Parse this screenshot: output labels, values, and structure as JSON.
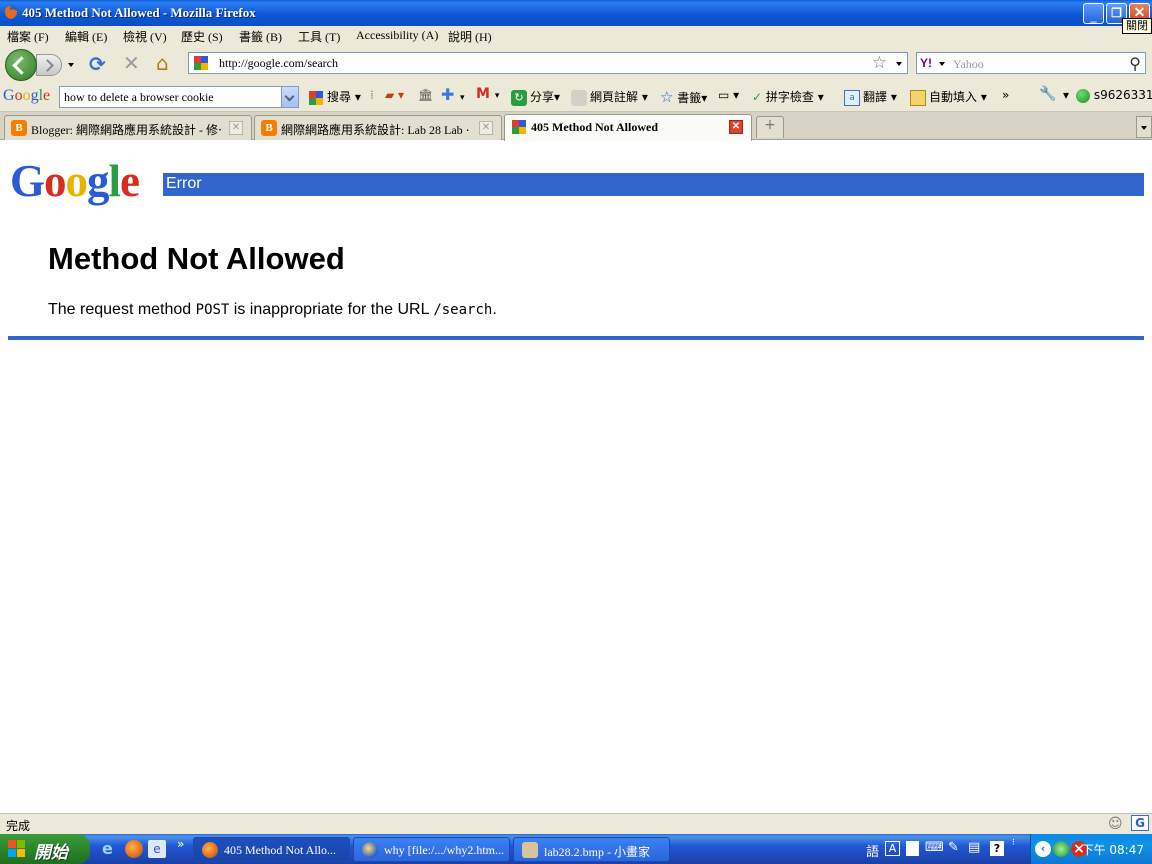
{
  "window": {
    "title": "405 Method Not Allowed - Mozilla Firefox",
    "close_tooltip": "關閉"
  },
  "menu": [
    "檔案 (F)",
    "編輯 (E)",
    "檢視 (V)",
    "歷史 (S)",
    "書籤 (B)",
    "工具 (T)",
    "Accessibility (A)",
    "說明 (H)"
  ],
  "nav": {
    "url": "http://google.com/search",
    "search_placeholder": "Yahoo",
    "search_engine_icon": "Y!"
  },
  "google_toolbar": {
    "logo": "Google",
    "query": "how to delete a browser cookie",
    "search_label": "搜尋",
    "share_label": "分享",
    "annotate_label": "網頁註解",
    "bookmarks_label": "書籤",
    "spellcheck_label": "拼字檢查",
    "translate_label": "翻譯",
    "autofill_label": "自動填入",
    "more_label": "»",
    "account": "s9626331"
  },
  "tabs": [
    {
      "label": "Blogger: 網際網路應用系統設計 - 修⋯",
      "icon": "blogger-icon"
    },
    {
      "label": "網際網路應用系統設計: Lab 28 Lab ⋯",
      "icon": "blogger-icon"
    },
    {
      "label": "405 Method Not Allowed",
      "icon": "google-icon",
      "active": true
    }
  ],
  "page": {
    "logo": "Google",
    "bar_label": "Error",
    "heading": "Method Not Allowed",
    "message_prefix": "The request method ",
    "method": "POST",
    "message_middle": " is inappropriate for the URL ",
    "path": "/search",
    "message_suffix": "."
  },
  "status": {
    "text": "完成"
  },
  "taskbar": {
    "start_label": "開始",
    "more": "»",
    "tasks": [
      {
        "label": "405 Method Not Allo...",
        "active": true
      },
      {
        "label": "why [file:/.../why2.htm..."
      },
      {
        "label": "lab28.2.bmp - 小畫家"
      }
    ],
    "clock": "下午 08:47",
    "ime": "語"
  },
  "colors": {
    "accent_blue": "#3366cc",
    "google_blue": "#2a5ad7",
    "google_red": "#d62d20",
    "google_yellow": "#e8b400",
    "google_green": "#2a9d3f"
  }
}
